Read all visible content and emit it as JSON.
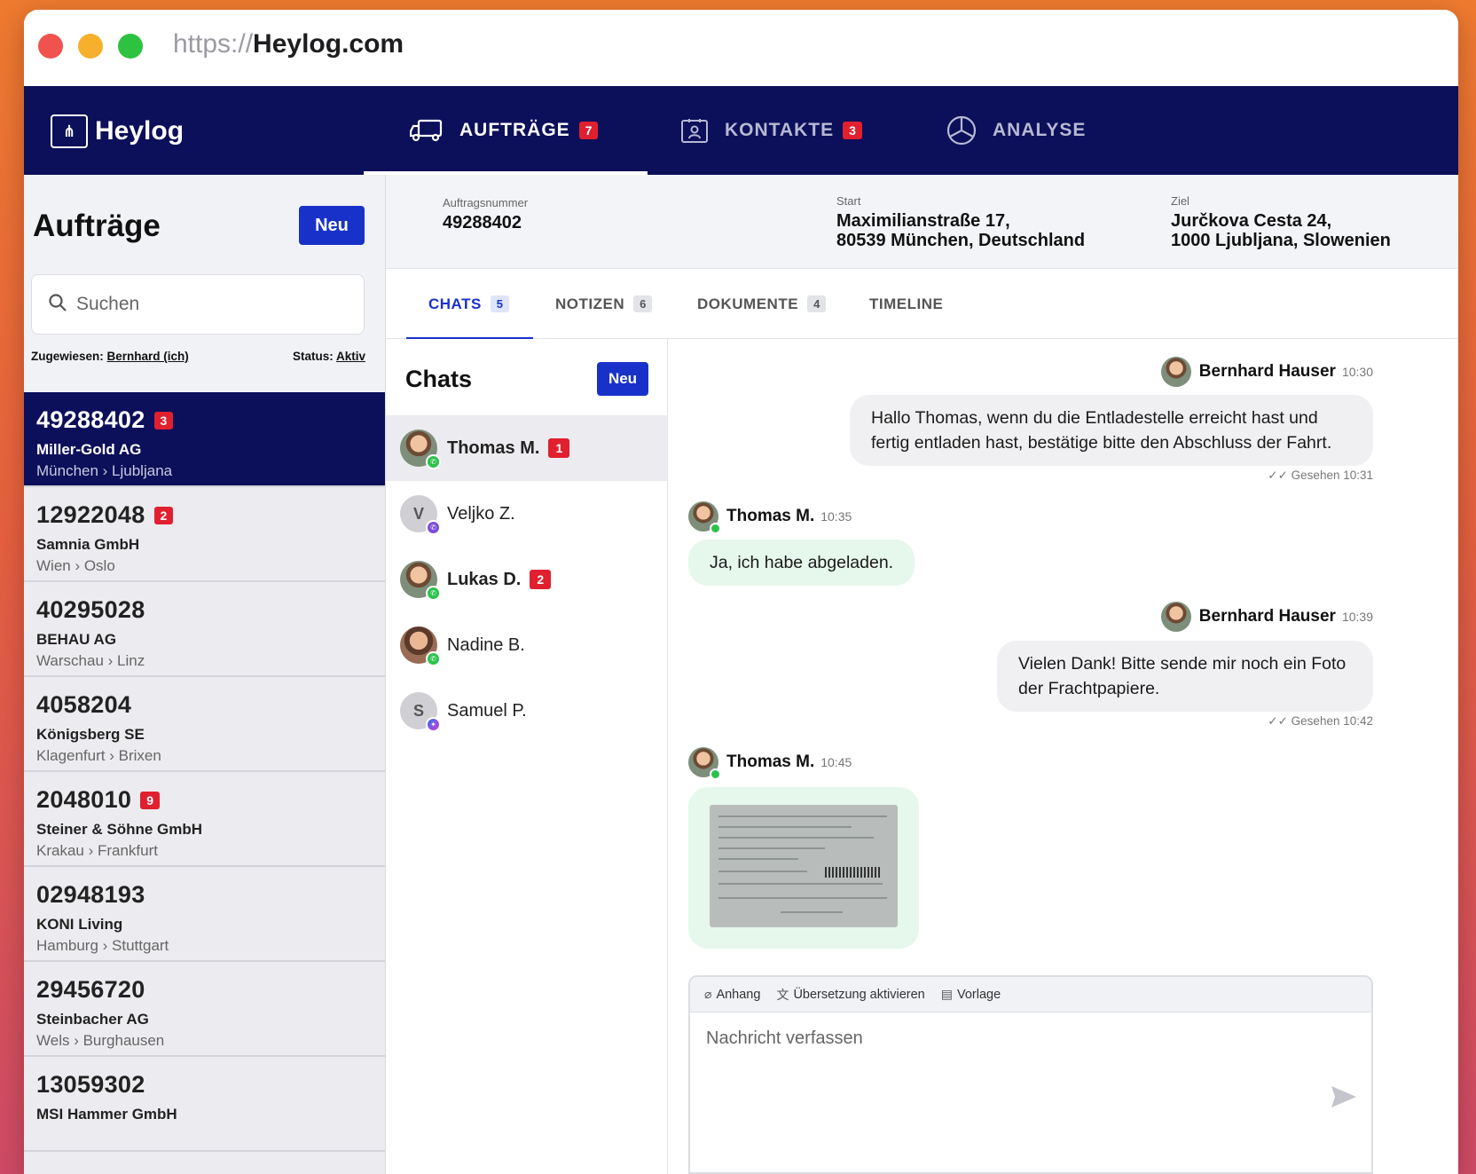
{
  "browser": {
    "url_protocol": "https://",
    "url_host": "Heylog.com"
  },
  "brand": {
    "name": "Heylog"
  },
  "nav": {
    "tabs": [
      {
        "label": "AUFTRÄGE",
        "badge": "7",
        "icon": "truck-icon"
      },
      {
        "label": "KONTAKTE",
        "badge": "3",
        "icon": "contact-card-icon"
      },
      {
        "label": "ANALYSE",
        "badge": "",
        "icon": "pie-chart-icon"
      }
    ]
  },
  "orders_panel": {
    "title": "Aufträge",
    "new_label": "Neu",
    "search_placeholder": "Suchen",
    "filter_assigned_label": "Zugewiesen:",
    "filter_assigned_value": "Bernhard (ich)",
    "filter_status_label": "Status:",
    "filter_status_value": "Aktiv",
    "orders": [
      {
        "number": "49288402",
        "badge": "3",
        "company": "Miller-Gold AG",
        "route": "München › Ljubljana"
      },
      {
        "number": "12922048",
        "badge": "2",
        "company": "Samnia GmbH",
        "route": "Wien › Oslo"
      },
      {
        "number": "40295028",
        "badge": "",
        "company": "BEHAU AG",
        "route": "Warschau › Linz"
      },
      {
        "number": "4058204",
        "badge": "",
        "company": "Königsberg SE",
        "route": "Klagenfurt › Brixen"
      },
      {
        "number": "2048010",
        "badge": "9",
        "company": "Steiner & Söhne GmbH",
        "route": "Krakau › Frankfurt"
      },
      {
        "number": "02948193",
        "badge": "",
        "company": "KONI Living",
        "route": "Hamburg › Stuttgart"
      },
      {
        "number": "29456720",
        "badge": "",
        "company": "Steinbacher AG",
        "route": "Wels › Burghausen"
      },
      {
        "number": "13059302",
        "badge": "",
        "company": "MSI Hammer GmbH",
        "route": ""
      }
    ]
  },
  "order_header": {
    "number_label": "Auftragsnummer",
    "number_value": "49288402",
    "start_label": "Start",
    "start_line1": "Maximilianstraße 17,",
    "start_line2": "80539 München, Deutschland",
    "target_label": "Ziel",
    "target_line1": "Jurčkova Cesta 24,",
    "target_line2": "1000 Ljubljana, Slowenien"
  },
  "detail_tabs": [
    {
      "label": "CHATS",
      "count": "5"
    },
    {
      "label": "NOTIZEN",
      "count": "6"
    },
    {
      "label": "DOKUMENTE",
      "count": "4"
    },
    {
      "label": "TIMELINE",
      "count": ""
    }
  ],
  "chats_panel": {
    "title": "Chats",
    "new_label": "Neu",
    "contacts": [
      {
        "name": "Thomas M.",
        "badge": "1",
        "initial": "",
        "channel": "whatsapp-icon"
      },
      {
        "name": "Veljko Z.",
        "badge": "",
        "initial": "V",
        "channel": "viber-icon"
      },
      {
        "name": "Lukas D.",
        "badge": "2",
        "initial": "",
        "channel": "whatsapp-icon"
      },
      {
        "name": "Nadine B.",
        "badge": "",
        "initial": "",
        "channel": "whatsapp-icon"
      },
      {
        "name": "Samuel P.",
        "badge": "",
        "initial": "S",
        "channel": "messenger-icon"
      }
    ]
  },
  "conversation": {
    "messages": [
      {
        "sender": "Bernhard Hauser",
        "time": "10:30",
        "text": "Hallo Thomas, wenn du die Entladestelle erreicht hast und fertig entladen hast, bestätige bitte den Abschluss der Fahrt.",
        "seen": "✓✓ Gesehen 10:31"
      },
      {
        "sender": "Thomas M.",
        "time": "10:35",
        "text": "Ja, ich habe abgeladen.",
        "seen": ""
      },
      {
        "sender": "Bernhard Hauser",
        "time": "10:39",
        "text": "Vielen Dank! Bitte sende mir noch ein Foto der Frachtpapiere.",
        "seen": "✓✓ Gesehen 10:42"
      },
      {
        "sender": "Thomas M.",
        "time": "10:45",
        "text": "",
        "seen": ""
      }
    ],
    "composer": {
      "attach_label": "Anhang",
      "translate_label": "Übersetzung aktivieren",
      "template_label": "Vorlage",
      "placeholder": "Nachricht verfassen"
    }
  },
  "colors": {
    "nav_bg": "#0c0f59",
    "accent": "#1832c9",
    "badge_red": "#e0202f",
    "incoming_bubble": "#e6f7ec"
  }
}
